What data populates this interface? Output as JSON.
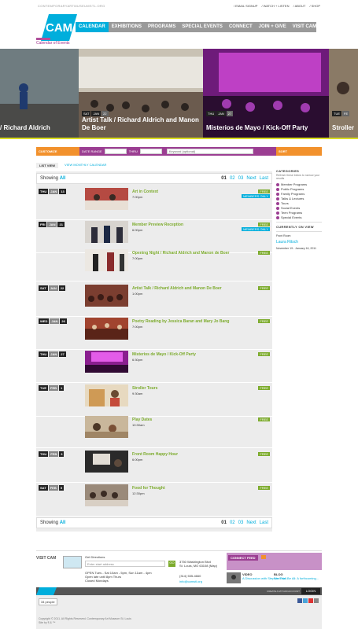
{
  "header": {
    "site_url": "CONTEMPORARYARTMUSEUMSTL.ORG",
    "utility": [
      "/ EMAIL SIGNUP",
      "/ WATCH + LISTEN",
      "/ ABOUT",
      "/ SHOP"
    ],
    "logo_text": "CAM",
    "nav": [
      "CALENDAR",
      "EXHIBITIONS",
      "PROGRAMS",
      "SPECIAL EVENTS",
      "CONNECT",
      "JOIN + GIVE",
      "VISIT CAM"
    ],
    "section_title": "Calendar of Events"
  },
  "hero": [
    {
      "caption": "/ Richard Aldrich",
      "dow": "",
      "mon": "",
      "day": ""
    },
    {
      "caption": "Artist Talk / Richard Aldrich and Manon De Boer",
      "dow": "SAT",
      "mon": "JAN",
      "day": "22"
    },
    {
      "caption": "Misterios de Mayo / Kick-Off Party",
      "dow": "THU",
      "mon": "JAN",
      "day": "27"
    },
    {
      "caption": "Stroller",
      "dow": "TUE",
      "mon": "FE",
      "day": ""
    }
  ],
  "filter": {
    "customize": "CUSTOMIZE",
    "date_range": "DATE RANGE",
    "thru": "THRU",
    "keyword_placeholder": "Keyword (optional)",
    "sort": "SORT"
  },
  "tabs": {
    "list": "LIST VIEW",
    "monthly": "VIEW MONTHLY CALENDAR"
  },
  "showing": {
    "label": "Showing",
    "value": "All",
    "pages": [
      "01",
      "02",
      "03"
    ],
    "next": "Next",
    "last": "Last"
  },
  "events": [
    {
      "dow": "THU",
      "mon": "JAN",
      "day": "13",
      "title": "Art in Context",
      "time": "7:00pm",
      "free": "FREE",
      "members": "MEMBERS ONLY"
    },
    {
      "dow": "FRI",
      "mon": "JAN",
      "day": "21",
      "title": "Member Preview Reception",
      "time": "6:00pm",
      "free": "FREE",
      "members": "MEMBERS ONLY"
    },
    {
      "dow": "",
      "mon": "",
      "day": "",
      "title": "Opening Night / Richard Aldrich and Manon de Boer",
      "time": "7:00pm",
      "free": "FREE",
      "members": ""
    },
    {
      "dow": "SAT",
      "mon": "JAN",
      "day": "22",
      "title": "Artist Talk / Richard Aldrich and Manon De Boer",
      "time": "1:00pm",
      "free": "FREE",
      "members": ""
    },
    {
      "dow": "WED",
      "mon": "JAN",
      "day": "26",
      "title": "Poetry Reading by Jessica Baran and Mary Jo Bang",
      "time": "7:00pm",
      "free": "FREE",
      "members": ""
    },
    {
      "dow": "THU",
      "mon": "JAN",
      "day": "27",
      "title": "Misterios de Mayo / Kick-Off Party",
      "time": "6:30pm",
      "free": "FREE",
      "members": ""
    },
    {
      "dow": "TUE",
      "mon": "FEB",
      "day": "1",
      "title": "Stroller Tours",
      "time": "9:30am",
      "free": "FREE",
      "members": ""
    },
    {
      "dow": "",
      "mon": "",
      "day": "",
      "title": "Play Dates",
      "time": "10:30am",
      "free": "FREE",
      "members": ""
    },
    {
      "dow": "THU",
      "mon": "FEB",
      "day": "3",
      "title": "Front Room Happy Hour",
      "time": "6:00pm",
      "free": "FREE",
      "members": ""
    },
    {
      "dow": "SAT",
      "mon": "FEB",
      "day": "5",
      "title": "Food for Thought",
      "time": "12:30pm",
      "free": "FREE",
      "members": ""
    }
  ],
  "sidebar": {
    "categories_title": "CATEGORIES",
    "categories_hint": "Refresh these below to narrow your results",
    "categories": [
      "Member Programs",
      "Public Programs",
      "Family Programs",
      "Talks & Lectures",
      "Tours",
      "Social Events",
      "Teen Programs",
      "Special Events"
    ],
    "view_title": "CURRENTLY ON VIEW",
    "view_room": "Front Room",
    "view_name": "Laura Ritsch",
    "view_dates": "November 19 - January 16, 2011"
  },
  "footer": {
    "visit": "VISIT CAM",
    "get_directions": "Get Directions",
    "address_placeholder": "Enter start address",
    "go": "GO",
    "hours": [
      "OPEN Tues - Sat 10am - 5pm, Sun 11am - 4pm",
      "Open late until 8pm Thurs",
      "Closed Mondays"
    ],
    "location": [
      "3750 Washington Blvd",
      "St. Louis, MO 63108 (Map)"
    ],
    "phone": "(314) 535-4660",
    "email": "info@camstl.org",
    "connect_feed": "CONNECT FEED",
    "feed1_title": "VIDEO",
    "feed1_text": "A Discussion with Stephen Prin...",
    "feed2_title": "BLOG",
    "feed2_text": "We Shall Be All: A forthcoming...",
    "copyright_bar": "CREATE A MYCAM ACCOUNT",
    "login": "LOGIN",
    "people": "34 people",
    "copyright": "Copyright © 2011. All Rights Reserved. Contemporary Art Museum St. Louis",
    "credits": "Site by ¶ & ™"
  },
  "colors": {
    "accent": "#00aedc",
    "purple": "#9b3e92",
    "green": "#7cab2c",
    "orange": "#f2912c"
  }
}
